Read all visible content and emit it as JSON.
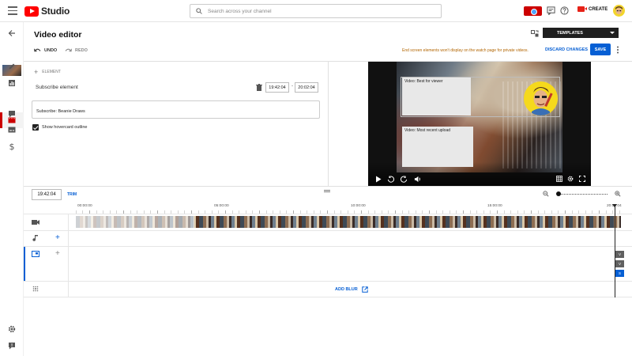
{
  "header": {
    "logo_text": "Studio",
    "search_placeholder": "Search across your channel",
    "create_label": "CREATE"
  },
  "editor": {
    "title": "Video editor",
    "undo_label": "UNDO",
    "redo_label": "REDO",
    "templates_label": "TEMPLATES",
    "warning": "End screen elements won't display on the watch page for private videos.",
    "discard_label": "DISCARD CHANGES",
    "save_label": "SAVE"
  },
  "element_panel": {
    "add_element_label": "ELEMENT",
    "element_name": "Subscribe element",
    "start_time": "19:42:04",
    "end_time": "20:02:04",
    "separator": "-",
    "subscribe_channel": "Subscribe: Beanie Draws",
    "show_outline_label": "Show hovercard outline",
    "show_outline_checked": true
  },
  "preview": {
    "card_1": "Video: Best for viewer",
    "card_2": "Video: Most recent upload"
  },
  "timeline": {
    "current_time": "19:42:04",
    "trim_label": "TRIM",
    "ruler_labels": [
      "00:00:00",
      "05:00:00",
      "10:00:00",
      "15:00:00",
      "20:00:04"
    ],
    "add_blur_label": "ADD BLUR",
    "end_screen_chips": [
      {
        "label": "V",
        "color": "#606060"
      },
      {
        "label": "V",
        "color": "#606060"
      },
      {
        "label": "S",
        "color": "#065fd4"
      }
    ]
  },
  "colors": {
    "brand_red": "#ff0000",
    "accent_blue": "#065fd4",
    "warning_orange": "#b26500"
  }
}
